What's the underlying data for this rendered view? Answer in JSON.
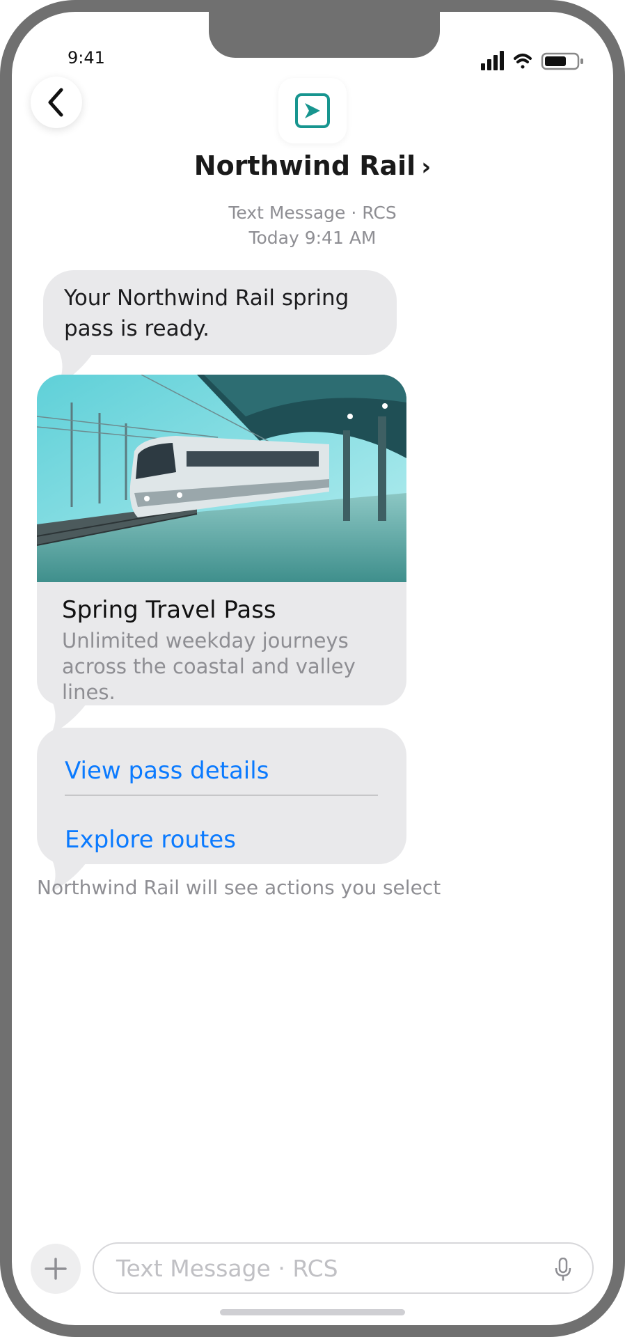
{
  "status_bar": {
    "time": "9:41"
  },
  "header": {
    "contact_name": "Northwind Rail",
    "chevron": "›",
    "channel": "Text Message · RCS",
    "timestamp": "Today 9:41 AM"
  },
  "messages": {
    "intro_text": "Your Northwind Rail spring pass is ready.",
    "card": {
      "title": "Spring Travel Pass",
      "description": "Unlimited weekday journeys across the coastal and valley lines."
    },
    "actions": [
      {
        "label": "View pass details"
      },
      {
        "label": "Explore routes"
      }
    ],
    "notice": "Northwind Rail will see actions you select"
  },
  "composer": {
    "placeholder": "Text Message · RCS"
  },
  "colors": {
    "accent_link": "#0a7aff",
    "bubble_bg": "#e9e9eb",
    "brand_teal": "#17958f",
    "frame": "#707070"
  },
  "icons": {
    "back": "chevron-left-icon",
    "logo": "northwind-rail-logo-icon",
    "add": "plus-icon",
    "mic": "microphone-icon",
    "signal": "signal-icon",
    "wifi": "wifi-icon",
    "battery": "battery-icon"
  }
}
